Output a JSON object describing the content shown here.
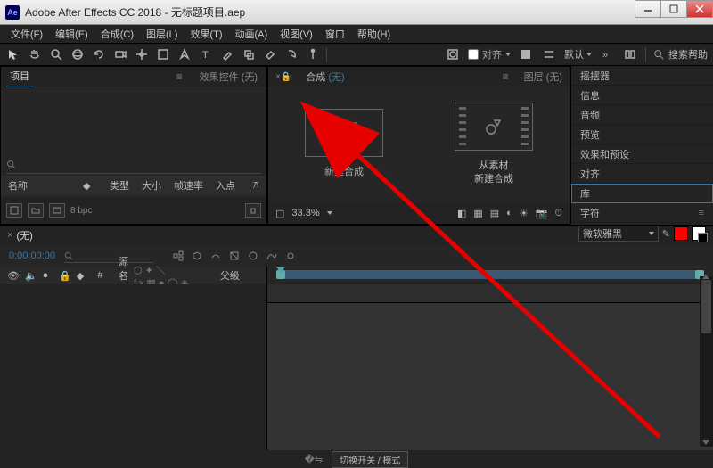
{
  "window": {
    "title": "Adobe After Effects CC 2018 - 无标题项目.aep",
    "app_abbr": "Ae"
  },
  "menu": [
    "文件(F)",
    "编辑(E)",
    "合成(C)",
    "图层(L)",
    "效果(T)",
    "动画(A)",
    "视图(V)",
    "窗口",
    "帮助(H)"
  ],
  "toolbar": {
    "snap_label": "对齐",
    "workspace": "默认",
    "search_placeholder": "搜索帮助"
  },
  "project": {
    "tab_project": "项目",
    "tab_effects": "效果控件 (无)",
    "columns": {
      "name": "名称",
      "type": "类型",
      "size": "大小",
      "fps": "帧速率",
      "in": "入点"
    },
    "bpc": "8 bpc"
  },
  "composition": {
    "tab_comp_prefix": "合成",
    "tab_comp_none": "(无)",
    "tab_layer": "图层 (无)",
    "new_comp": "新建合成",
    "from_footage_line1": "从素材",
    "from_footage_line2": "新建合成",
    "zoom": "33.3%"
  },
  "right_panels": [
    "摇摆器",
    "信息",
    "音频",
    "预览",
    "效果和预设",
    "对齐",
    "库",
    "字符"
  ],
  "character": {
    "font": "微软雅黑"
  },
  "timeline": {
    "tab": "(无)",
    "timecode": "0:00:00:00",
    "col_source": "源名称",
    "col_parent": "父级",
    "toggle_label": "切换开关 / 模式"
  }
}
